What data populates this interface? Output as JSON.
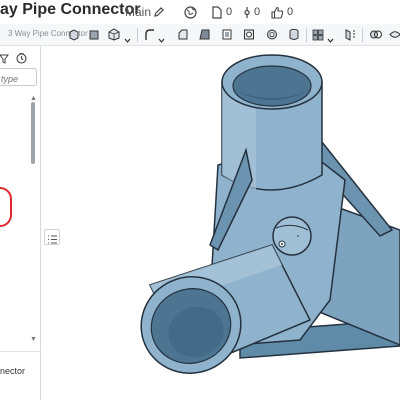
{
  "titlebar": {
    "doc_title": "ay Pipe Connector",
    "branch": "Main",
    "versions_count": "0",
    "branches_count": "0",
    "likes_count": "0"
  },
  "toolbar": {
    "breadcrumb": "3 Way Pipe Connector"
  },
  "left_panel": {
    "search_placeholder": "type",
    "part_item_label": "nector"
  },
  "icons": {
    "edit": "pencil-icon",
    "public": "globe-icon",
    "versions": "document-icon",
    "branches": "branch-icon",
    "likes": "thumbs-up-icon",
    "filter": "filter-icon",
    "history": "clock-icon",
    "list": "list-icon"
  },
  "colors": {
    "model_fill": "#8fb3cd",
    "model_dark": "#4d7591",
    "model_outline": "#24323f",
    "annotation": "#e0262b"
  }
}
